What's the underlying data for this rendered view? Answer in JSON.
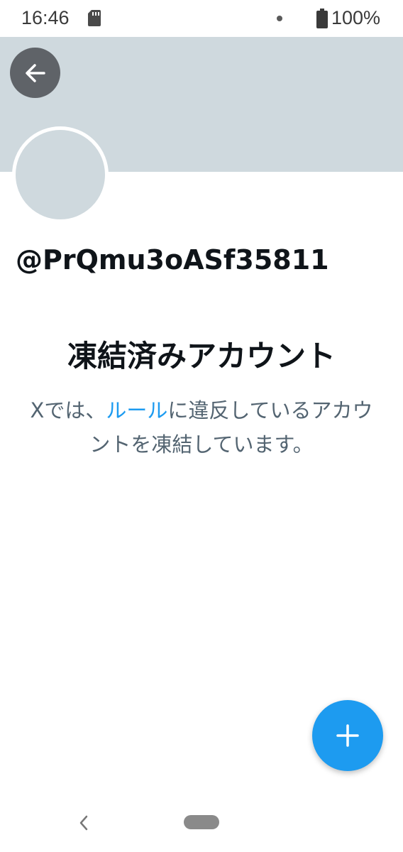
{
  "status_bar": {
    "time": "16:46",
    "battery_percent": "100%",
    "icons": [
      "sd-card-icon",
      "notification-dot-icon",
      "battery-icon"
    ]
  },
  "header": {
    "back_icon": "arrow-left-icon"
  },
  "profile": {
    "handle": "@PrQmu3oASf35811"
  },
  "suspended": {
    "title": "凍結済みアカウント",
    "message_before": "Xでは、",
    "rules_link": "ルール",
    "message_after": "に違反しているアカウントを凍結しています。"
  },
  "fab": {
    "icon": "plus-icon"
  },
  "nav": {
    "back_icon": "chevron-left-icon",
    "home_icon": "home-pill-icon"
  },
  "colors": {
    "banner": "#cfd9de",
    "link": "#1d9bf0",
    "fab": "#1d9bf0",
    "text_primary": "#0f1419",
    "text_secondary": "#536471"
  }
}
